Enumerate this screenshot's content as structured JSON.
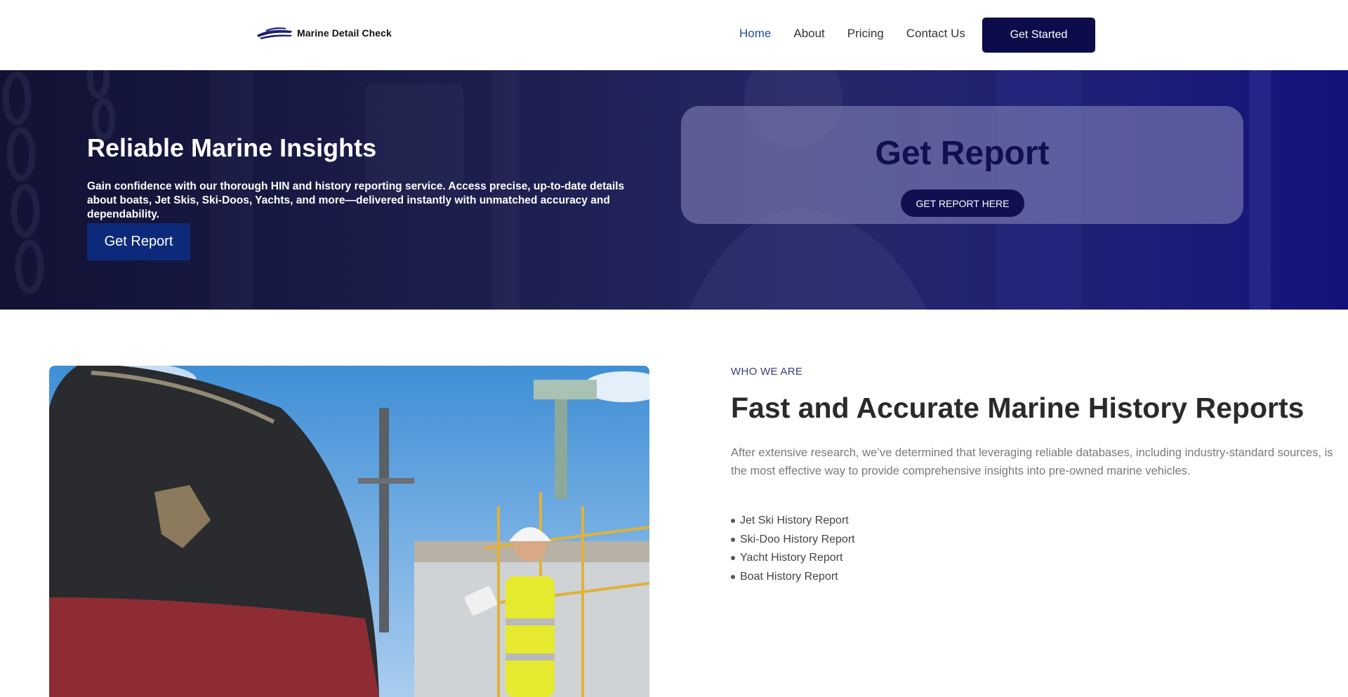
{
  "header": {
    "logo_text": "Marine Detail Check",
    "nav": [
      {
        "label": "Home",
        "active": true
      },
      {
        "label": "About",
        "active": false
      },
      {
        "label": "Pricing",
        "active": false
      },
      {
        "label": "Contact Us",
        "active": false
      }
    ],
    "cta_label": "Get Started"
  },
  "hero": {
    "title": "Reliable Marine Insights",
    "description": "Gain confidence with our thorough HIN and history reporting service. Access precise, up-to-date details about boats, Jet Skis, Ski-Doos, Yachts, and more—delivered instantly with unmatched accuracy and dependability.",
    "button_label": "Get Report",
    "card": {
      "title": "Get Report",
      "button_label": "GET REPORT HERE"
    }
  },
  "about": {
    "eyebrow": "WHO WE ARE",
    "title": "Fast and Accurate Marine History Reports",
    "description": "After extensive research, we’ve determined that leveraging reliable databases, including industry-standard sources, is the most effective way to provide comprehensive insights into pre-owned marine vehicles.",
    "reports": [
      "Jet Ski History Report",
      "Ski-Doo History Report",
      "Yacht History Report",
      "Boat History Report"
    ]
  },
  "colors": {
    "brand_navy": "#0c0c4a",
    "nav_active": "#1e4f9c",
    "eyebrow": "#3d3a7a"
  }
}
